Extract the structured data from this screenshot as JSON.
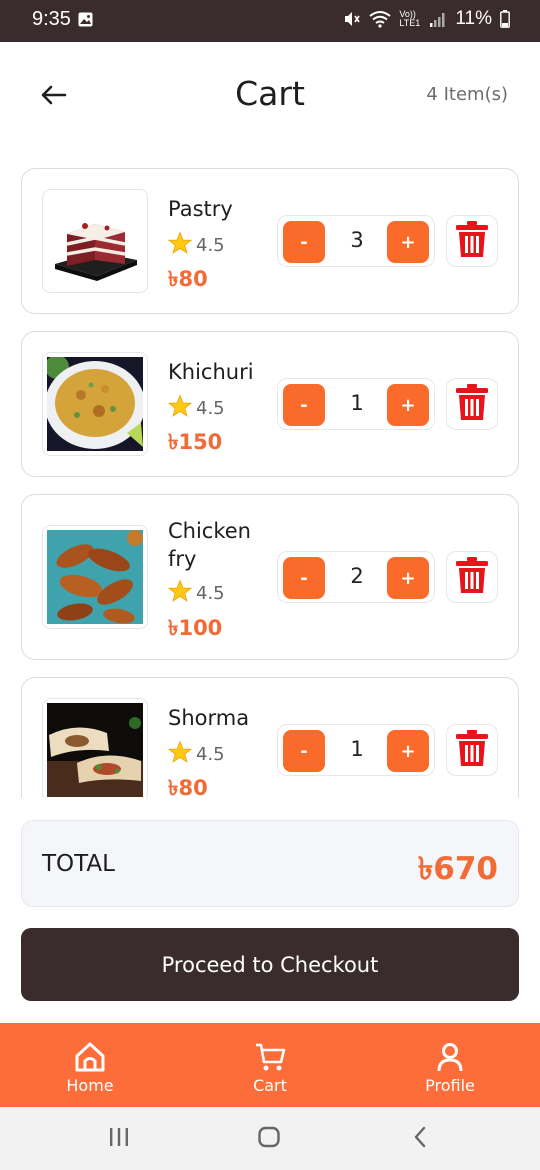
{
  "status_bar": {
    "time": "9:35",
    "battery": "11%",
    "network": "Vo)) LTE1"
  },
  "header": {
    "title": "Cart",
    "item_count": "4 Item(s)"
  },
  "cart": {
    "items": [
      {
        "name": "Pastry",
        "rating": "4.5",
        "price": "৳80",
        "quantity": "3",
        "minus_label": "-",
        "plus_label": "+"
      },
      {
        "name": "Khichuri",
        "rating": "4.5",
        "price": "৳150",
        "quantity": "1",
        "minus_label": "-",
        "plus_label": "+"
      },
      {
        "name": "Chicken fry",
        "rating": "4.5",
        "price": "৳100",
        "quantity": "2",
        "minus_label": "-",
        "plus_label": "+"
      },
      {
        "name": "Shorma",
        "rating": "4.5",
        "price": "৳80",
        "quantity": "1",
        "minus_label": "-",
        "plus_label": "+"
      }
    ]
  },
  "summary": {
    "total_label": "TOTAL",
    "total_value": "৳670"
  },
  "checkout": {
    "label": "Proceed to Checkout"
  },
  "bottom_nav": {
    "home": "Home",
    "cart": "Cart",
    "profile": "Profile"
  },
  "colors": {
    "accent": "#fd6d39",
    "price": "#f26a35",
    "dark": "#3a2c2c",
    "delete": "#e8141b"
  },
  "icons": [
    "arrow-left-icon",
    "star-icon",
    "trash-icon",
    "home-icon",
    "cart-icon",
    "profile-icon"
  ]
}
